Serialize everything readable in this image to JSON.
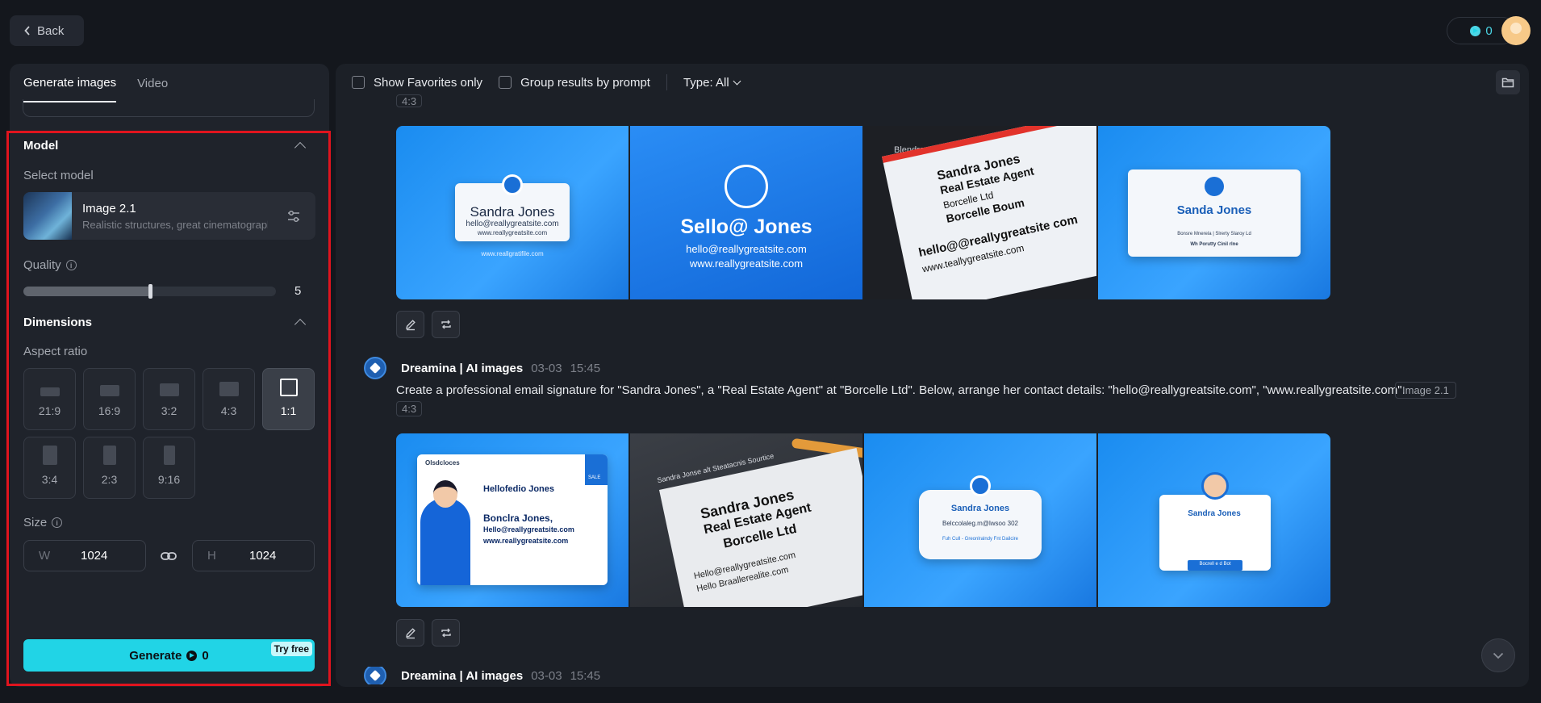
{
  "topbar": {
    "back_label": "Back",
    "credits": "0"
  },
  "sidebar": {
    "tabs": [
      {
        "label": "Generate images",
        "active": true
      },
      {
        "label": "Video",
        "active": false
      }
    ],
    "model": {
      "title": "Model",
      "select_label": "Select model",
      "name": "Image 2.1",
      "description": "Realistic structures, great cinematography"
    },
    "quality": {
      "label": "Quality",
      "value": "5",
      "level": 0.5
    },
    "dimensions": {
      "title": "Dimensions",
      "aspect_label": "Aspect ratio",
      "ratios": [
        "21:9",
        "16:9",
        "3:2",
        "4:3",
        "1:1",
        "3:4",
        "2:3",
        "9:16"
      ],
      "selected_ratio": "1:1",
      "size_label": "Size",
      "width_prefix": "W",
      "width": "1024",
      "height_prefix": "H",
      "height": "1024"
    },
    "generate": {
      "label": "Generate",
      "cost": "0",
      "badge": "Try free"
    }
  },
  "main": {
    "filters": {
      "favorites": "Show Favorites only",
      "group": "Group results by prompt",
      "type": "Type: All"
    },
    "groups": [
      {
        "aspect": "4:3",
        "images": [
          {
            "line1": "Sandra Jones",
            "line2": "hello@reallygreatsite.com",
            "line3": "www.reallygreatsite.com",
            "footer": "www.reallgratifile.com"
          },
          {
            "line1": "Sello@ Jones",
            "line2": "hello@reallygreatsite.com",
            "line3": "www.reallygreatsite.com"
          },
          {
            "line1": "Sandra Jones",
            "line2": "Real Estate Agent",
            "line3": "Borcelle Ltd",
            "line4": "Borcelle Boum",
            "line5": "hello@@reallygreatsite com",
            "line6": "www.teallygreatsite.com",
            "top": "Blendra Jones"
          },
          {
            "line1": "Sanda Jones",
            "line2": "Bonsre Mnerela | Slrerty Slaroy Ld",
            "line3": "Wh Porutty Cinil rlne"
          }
        ]
      },
      {
        "author": "Dreamina | AI images",
        "date": "03-03",
        "time": "15:45",
        "prompt": "Create a professional email signature for \"Sandra Jones\", a \"Real Estate Agent\" at \"Borcelle Ltd\". Below, arrange her contact details: \"hello@reallygreatsite.com\", \"www.reallygreatsite.com\".",
        "model": "Image 2.1",
        "aspect": "4:3",
        "images": [
          {
            "line1": "Hellofedio Jones",
            "line2": "Bonclra Jones,",
            "line3": "Hello@reallygreatsite.com",
            "line4": "www.reallygreatsite.com",
            "logo": "Olsdcloces",
            "badge": "SALE"
          },
          {
            "line1": "Sandra Jones",
            "line2": "Real Estate Agent",
            "line3": "Borcelle Ltd",
            "line4": "Hello@reallygreatsite.com",
            "line5": "Hello Braallerealite.com",
            "top": "Sandra Jonse alt Steatacnis Sourtice"
          },
          {
            "line1": "Sandra Jones",
            "line2": "Belccolaleg.m@lwsoo 302",
            "line3": "Fuh Cull - Greonlralndy Fnt Dailcire"
          },
          {
            "line1": "Sandra Jones",
            "line2": "Bocrell e d Bot"
          }
        ]
      },
      {
        "author": "Dreamina | AI images",
        "date": "03-03",
        "time": "15:45"
      }
    ]
  }
}
